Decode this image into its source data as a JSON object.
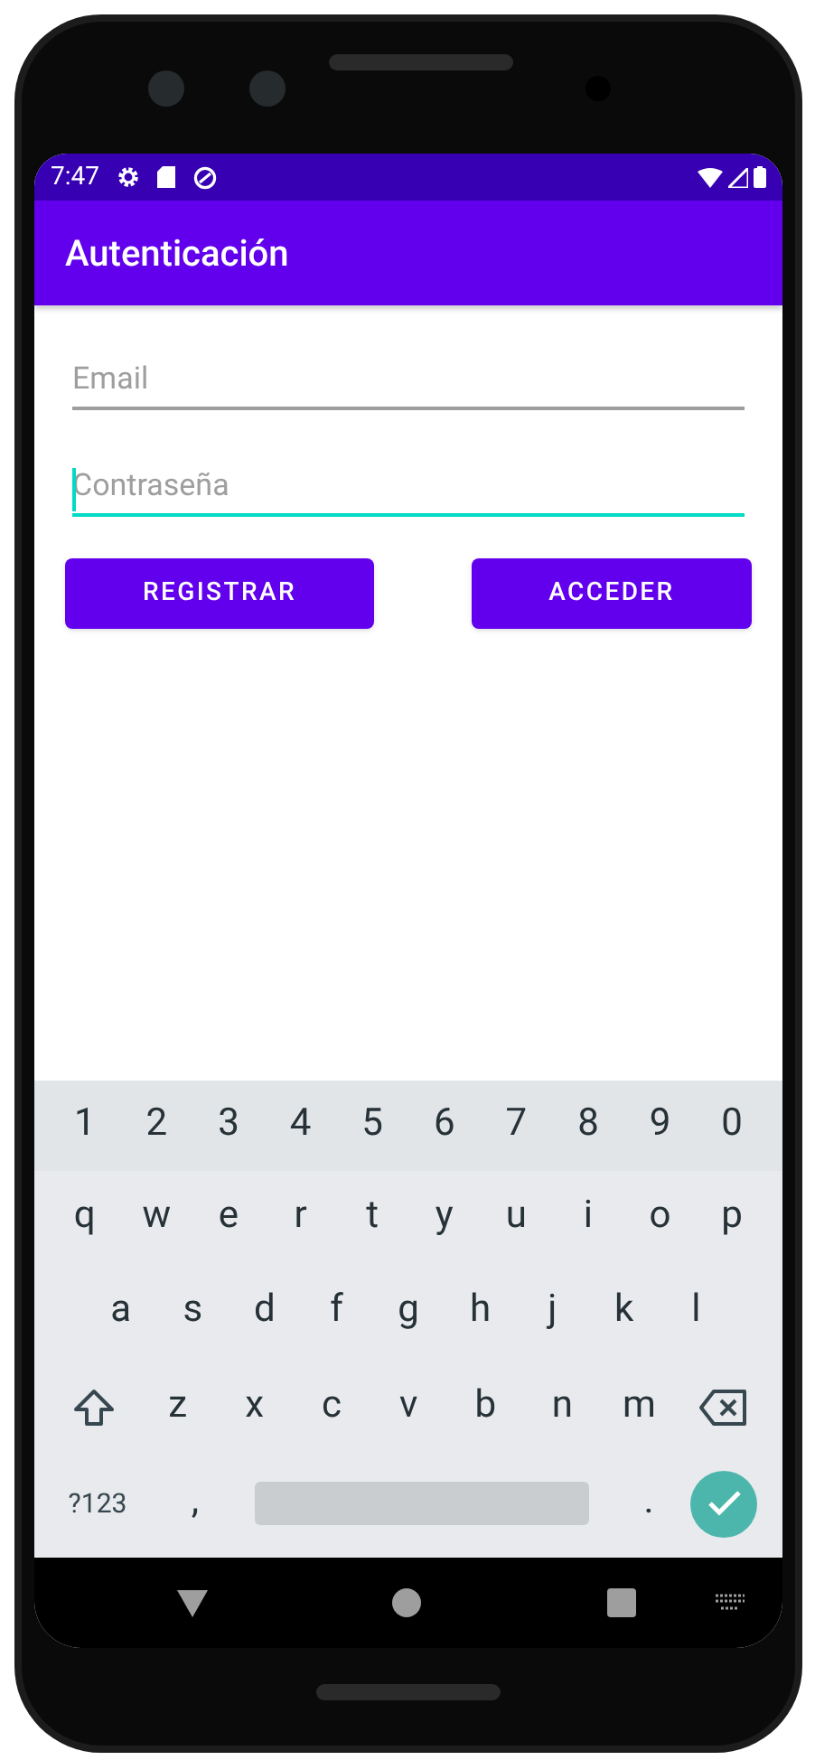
{
  "status_bar": {
    "time": "7:47"
  },
  "app_bar": {
    "title": "Autenticación"
  },
  "fields": [
    {
      "placeholder": "Email",
      "focused": false
    },
    {
      "placeholder": "Contraseña",
      "focused": true
    }
  ],
  "buttons": [
    "REGISTRAR",
    "ACCEDER"
  ],
  "keyboard": {
    "rows": [
      [
        {
          "kind": "char",
          "label": "1"
        },
        {
          "kind": "char",
          "label": "2"
        },
        {
          "kind": "char",
          "label": "3"
        },
        {
          "kind": "char",
          "label": "4"
        },
        {
          "kind": "char",
          "label": "5"
        },
        {
          "kind": "char",
          "label": "6"
        },
        {
          "kind": "char",
          "label": "7"
        },
        {
          "kind": "char",
          "label": "8"
        },
        {
          "kind": "char",
          "label": "9"
        },
        {
          "kind": "char",
          "label": "0"
        }
      ],
      [
        {
          "kind": "char",
          "label": "q"
        },
        {
          "kind": "char",
          "label": "w"
        },
        {
          "kind": "char",
          "label": "e"
        },
        {
          "kind": "char",
          "label": "r"
        },
        {
          "kind": "char",
          "label": "t"
        },
        {
          "kind": "char",
          "label": "y"
        },
        {
          "kind": "char",
          "label": "u"
        },
        {
          "kind": "char",
          "label": "i"
        },
        {
          "kind": "char",
          "label": "o"
        },
        {
          "kind": "char",
          "label": "p"
        }
      ],
      [
        {
          "kind": "char",
          "label": "a"
        },
        {
          "kind": "char",
          "label": "s"
        },
        {
          "kind": "char",
          "label": "d"
        },
        {
          "kind": "char",
          "label": "f"
        },
        {
          "kind": "char",
          "label": "g"
        },
        {
          "kind": "char",
          "label": "h"
        },
        {
          "kind": "char",
          "label": "j"
        },
        {
          "kind": "char",
          "label": "k"
        },
        {
          "kind": "char",
          "label": "l"
        }
      ],
      [
        {
          "kind": "shift"
        },
        {
          "kind": "char",
          "label": "z"
        },
        {
          "kind": "char",
          "label": "x"
        },
        {
          "kind": "char",
          "label": "c"
        },
        {
          "kind": "char",
          "label": "v"
        },
        {
          "kind": "char",
          "label": "b"
        },
        {
          "kind": "char",
          "label": "n"
        },
        {
          "kind": "char",
          "label": "m"
        },
        {
          "kind": "backspace"
        }
      ],
      [
        {
          "kind": "symbols",
          "label": "?123"
        },
        {
          "kind": "char",
          "label": ","
        },
        {
          "kind": "space"
        },
        {
          "kind": "char",
          "label": "."
        },
        {
          "kind": "enter"
        }
      ]
    ]
  }
}
